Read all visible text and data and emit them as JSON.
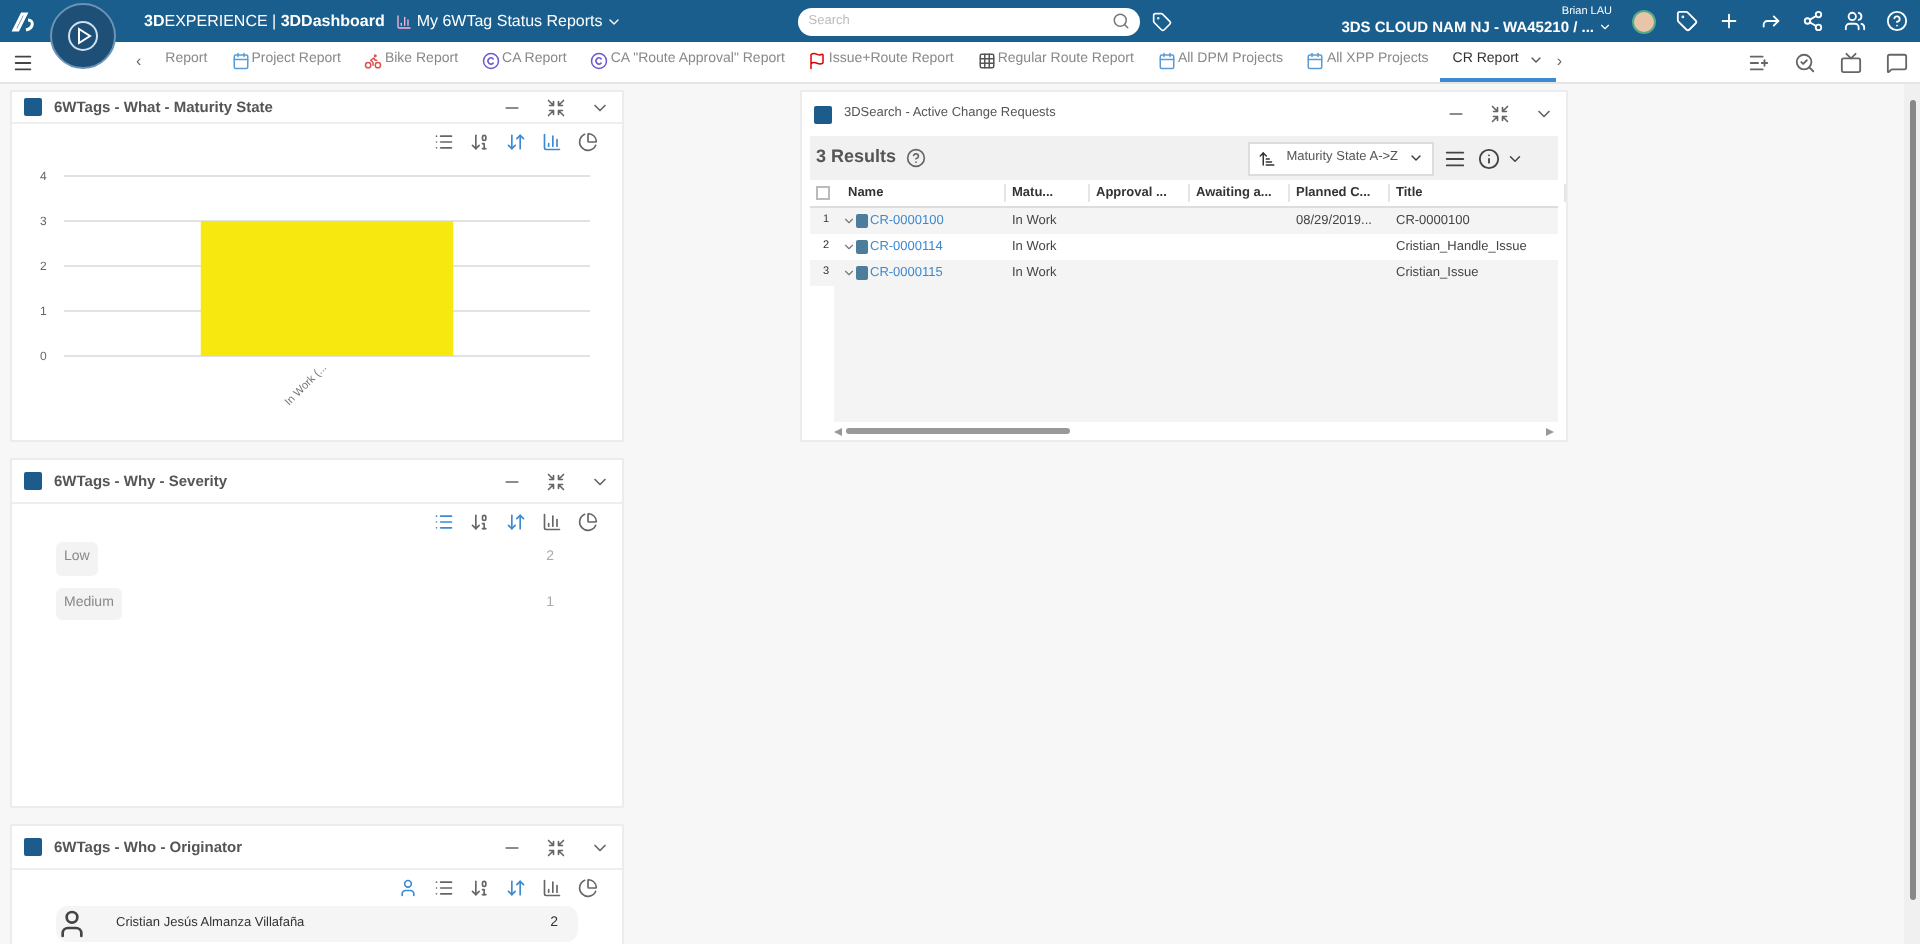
{
  "top_bar": {
    "brand": "**3D**EXPERIENCE | **3DDashboard**",
    "dashboard_title": "My 6WTag Status Reports",
    "search": {
      "placeholder": "Search"
    },
    "user_name": "Brian LAU",
    "tenant": "3DS CLOUD NAM NJ - WA45210 / ..."
  },
  "tab_bar": {
    "prev": "‹",
    "next": "›",
    "tabs": [
      {
        "label": "Report",
        "kind": "plain",
        "selected": false
      },
      {
        "label": "Project Report",
        "kind": "calendar",
        "selected": false
      },
      {
        "label": "Bike Report",
        "kind": "bike",
        "selected": false
      },
      {
        "label": "CA Report",
        "kind": "circle",
        "selected": false
      },
      {
        "label": "CA \"Route Approval\" Report",
        "kind": "circle",
        "selected": false
      },
      {
        "label": "Issue+Route Report",
        "kind": "flag",
        "selected": false
      },
      {
        "label": "Regular Route Report",
        "kind": "grid",
        "selected": false
      },
      {
        "label": "All DPM Projects",
        "kind": "calendar",
        "selected": false
      },
      {
        "label": "All XPP Projects",
        "kind": "calendar",
        "selected": false
      },
      {
        "label": "CR Report",
        "kind": "plain",
        "selected": true
      }
    ]
  },
  "widgets": [
    {
      "kind": "chart",
      "title": "6WTags - What - Maturity State",
      "tools": [
        {
          "kind": "list",
          "selected": false
        },
        {
          "kind": "sort-alpha",
          "selected": false
        },
        {
          "kind": "sort-count",
          "selected": true
        },
        {
          "kind": "bar",
          "selected": true
        },
        {
          "kind": "pie",
          "selected": false
        }
      ],
      "chart_data": {
        "type": "bar",
        "categories": [
          "In Work (..."
        ],
        "series": [
          {
            "color": "#f7e80f",
            "values": [
              3
            ]
          }
        ],
        "ylim": [
          0,
          4
        ],
        "yticks": [
          0,
          1,
          2,
          3,
          4
        ],
        "grid": true
      }
    },
    {
      "kind": "list",
      "title": "6WTags - Why - Severity",
      "tools": [
        {
          "kind": "list",
          "selected": true
        },
        {
          "kind": "sort-alpha",
          "selected": false
        },
        {
          "kind": "sort-count",
          "selected": true
        },
        {
          "kind": "bar",
          "selected": false
        },
        {
          "kind": "pie",
          "selected": false
        }
      ],
      "items": [
        {
          "label": "Low",
          "count": "2"
        },
        {
          "label": "Medium",
          "count": "1"
        }
      ]
    },
    {
      "kind": "people",
      "title": "6WTags - Who - Originator",
      "tools": [
        {
          "kind": "user",
          "selected": true
        },
        {
          "kind": "list",
          "selected": false
        },
        {
          "kind": "sort-alpha",
          "selected": false
        },
        {
          "kind": "sort-count",
          "selected": true
        },
        {
          "kind": "bar",
          "selected": false
        },
        {
          "kind": "pie",
          "selected": false
        }
      ],
      "items": [
        {
          "label": "Cristian Jesús Almanza Villafaña",
          "count": "2"
        }
      ]
    }
  ],
  "search_widget": {
    "title": "3DSearch - Active Change Requests",
    "results": "3 Results",
    "sort": "Maturity State A->Z",
    "select_all": {
      "checked": false
    },
    "columns": [
      "Name",
      "Matu...",
      "Approval ...",
      "Awaiting a...",
      "Planned C...",
      "Title"
    ],
    "rows": [
      {
        "index": "1",
        "name": "CR-0000100",
        "maturity": "In Work",
        "planned": "08/29/2019...",
        "title": "CR-0000100"
      },
      {
        "index": "2",
        "name": "CR-0000114",
        "maturity": "In Work",
        "title": "Cristian_Handle_Issue"
      },
      {
        "index": "3",
        "name": "CR-0000115",
        "maturity": "In Work",
        "title": "Cristian_Issue"
      }
    ]
  }
}
